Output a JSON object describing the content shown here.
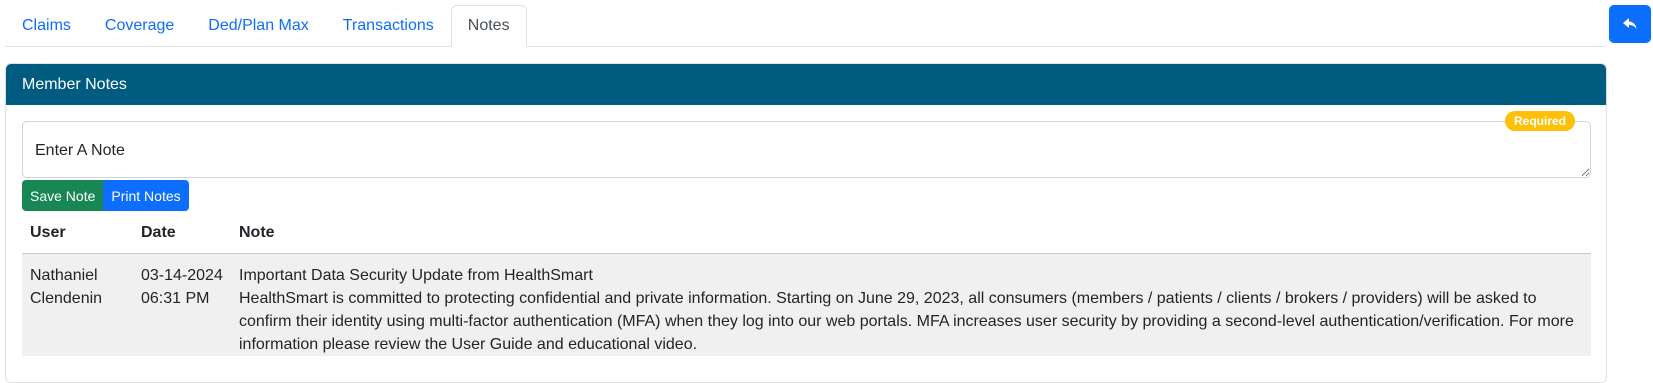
{
  "tabs": [
    {
      "label": "Claims",
      "active": false
    },
    {
      "label": "Coverage",
      "active": false
    },
    {
      "label": "Ded/Plan Max",
      "active": false
    },
    {
      "label": "Transactions",
      "active": false
    },
    {
      "label": "Notes",
      "active": true
    }
  ],
  "back_button": {
    "icon": "reply-arrow-icon"
  },
  "card": {
    "title": "Member Notes"
  },
  "note_input": {
    "placeholder": "Enter A Note",
    "required_badge": "Required"
  },
  "buttons": {
    "save": "Save Note",
    "print": "Print Notes"
  },
  "table": {
    "headers": {
      "user": "User",
      "date": "Date",
      "note": "Note"
    },
    "rows": [
      {
        "user_first": "Nathaniel",
        "user_last": "Clendenin",
        "date": "03-14-2024",
        "time": "06:31 PM",
        "note_title": "Important Data Security Update from HealthSmart",
        "note_body": "HealthSmart is committed to protecting confidential and private information. Starting on June 29, 2023, all consumers (members / patients / clients / brokers / providers) will be asked to confirm their identity using multi-factor authentication (MFA) when they log into our web portals. MFA increases user security by providing a second-level authentication/verification. For more information please review the User Guide and educational video."
      }
    ]
  },
  "colors": {
    "header_bg": "#005b80",
    "link": "#0d6efd",
    "save": "#198754",
    "badge": "#ffc107",
    "row_bg": "#f0f0f0"
  }
}
